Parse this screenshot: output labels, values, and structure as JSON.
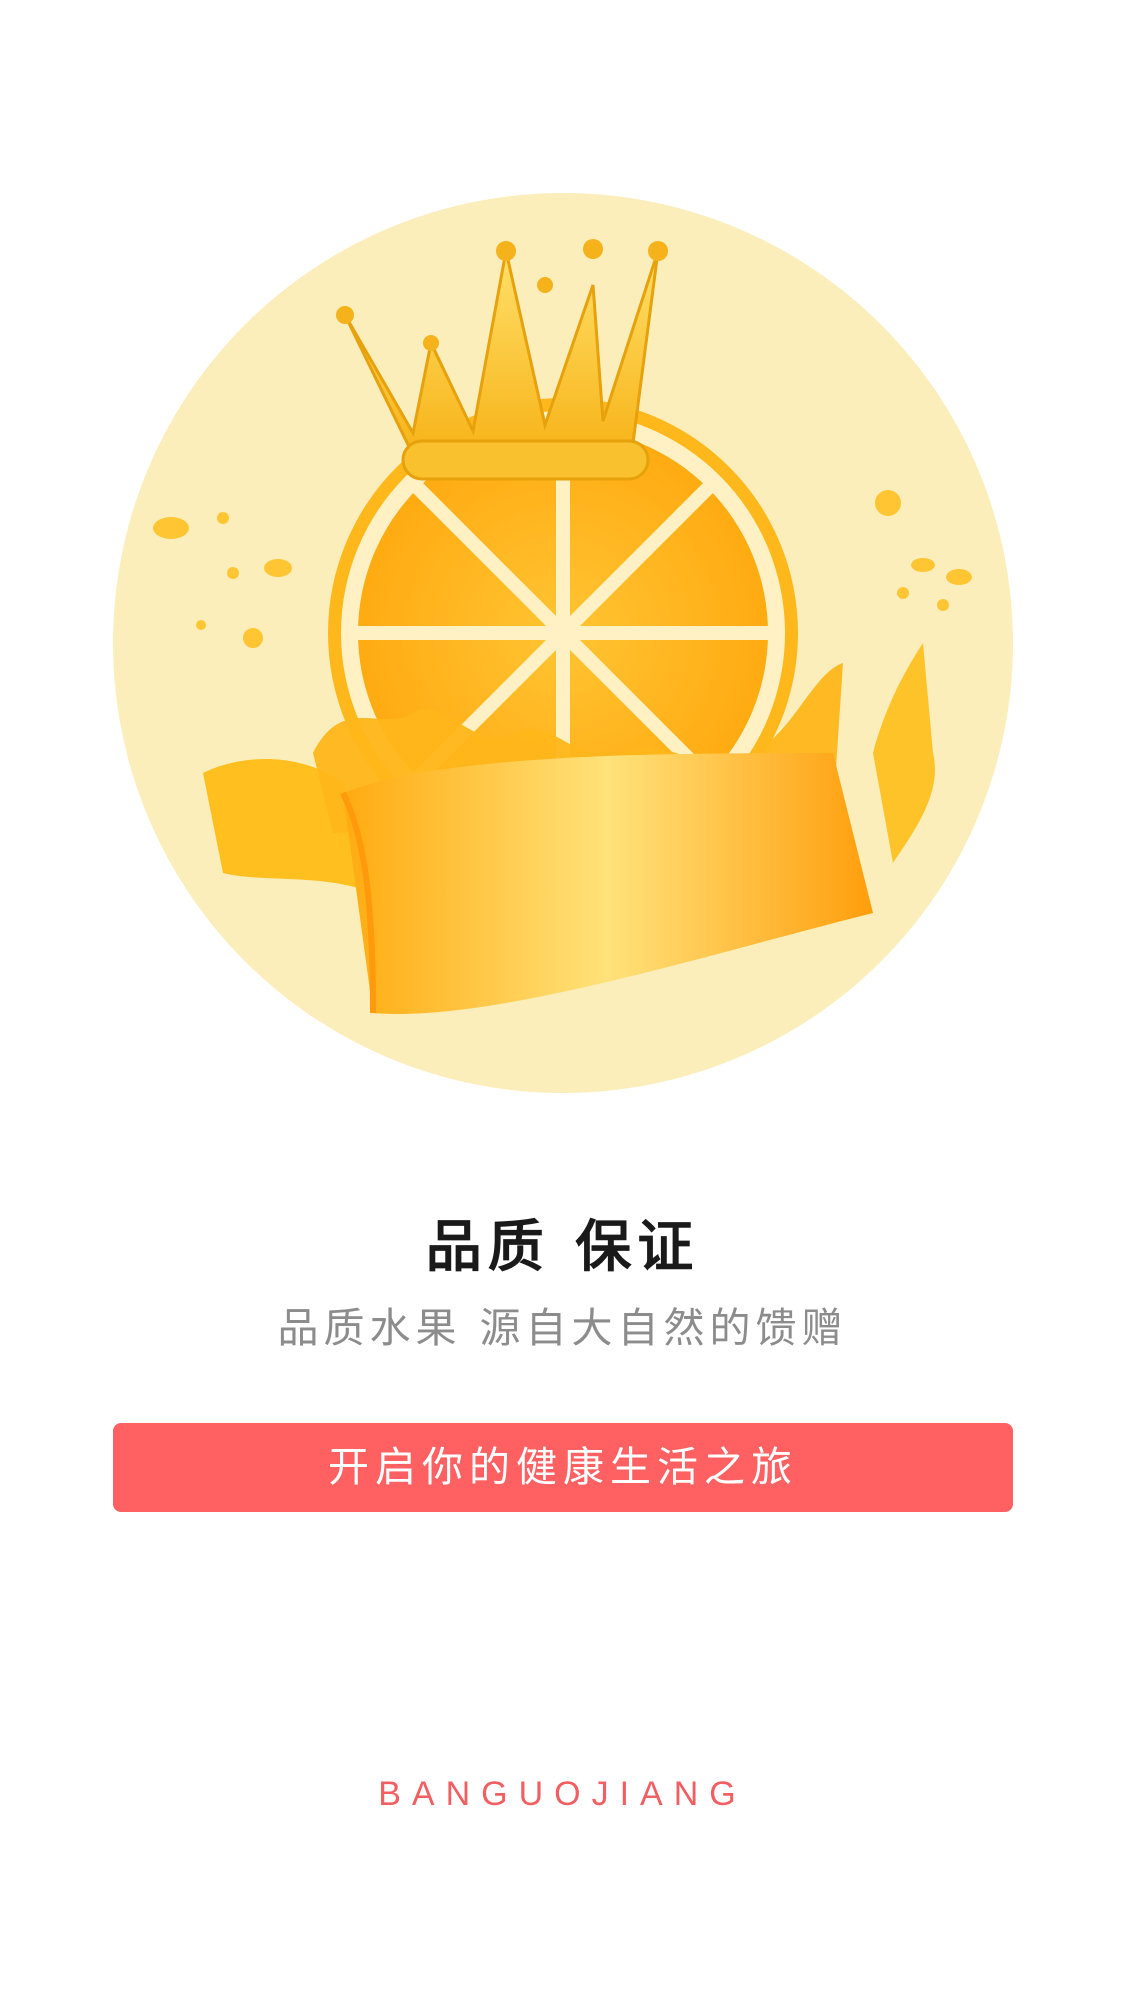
{
  "intro": {
    "title": "品质 保证",
    "subtitle": "品质水果 源自大自然的馈赠",
    "cta_label": "开启你的健康生活之旅",
    "brand": "BANGUOJIANG"
  },
  "illustration": {
    "subject": "orange-slice-with-crown-and-ribbon",
    "circle_color": "#fbeebb",
    "accent_color": "#ff6163"
  }
}
